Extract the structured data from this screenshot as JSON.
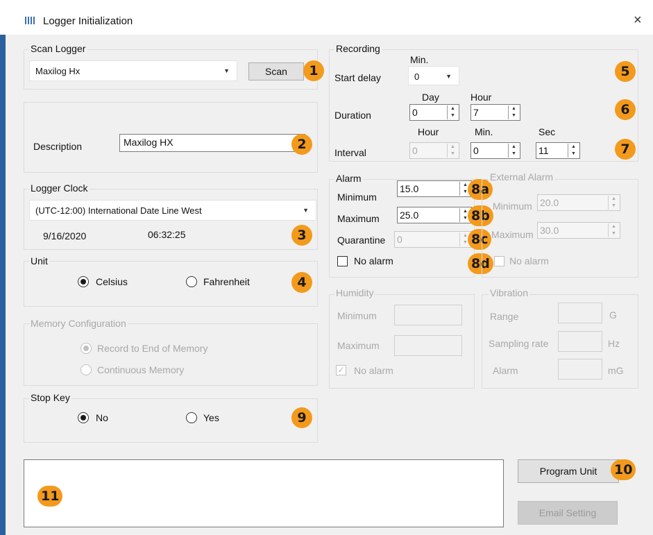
{
  "window": {
    "title": "Logger Initialization",
    "close_glyph": "×"
  },
  "scan_logger": {
    "group_label": "Scan Logger",
    "selected": "Maxilog Hx",
    "scan_label": "Scan",
    "badge": "1"
  },
  "description": {
    "label": "Description",
    "value": "Maxilog HX",
    "badge": "2"
  },
  "logger_clock": {
    "group_label": "Logger Clock",
    "timezone": "(UTC-12:00) International Date Line West",
    "date": "9/16/2020",
    "time": "06:32:25",
    "badge": "3"
  },
  "unit": {
    "group_label": "Unit",
    "celsius": "Celsius",
    "fahrenheit": "Fahrenheit",
    "selected": "Celsius",
    "badge": "4"
  },
  "memory": {
    "group_label": "Memory Configuration",
    "option1": "Record to End of Memory",
    "option2": "Continuous Memory"
  },
  "stop_key": {
    "group_label": "Stop Key",
    "no": "No",
    "yes": "Yes",
    "selected": "No",
    "badge": "9"
  },
  "recording": {
    "group_label": "Recording",
    "start_delay_label": "Start delay",
    "start_delay_unit": "Min.",
    "start_delay_value": "0",
    "badge_start": "5",
    "duration_label": "Duration",
    "duration_day_label": "Day",
    "duration_hour_label": "Hour",
    "duration_day": "0",
    "duration_hour": "7",
    "badge_duration": "6",
    "interval_label": "Interval",
    "interval_hour_label": "Hour",
    "interval_min_label": "Min.",
    "interval_sec_label": "Sec",
    "interval_hour": "0",
    "interval_min": "0",
    "interval_sec": "11",
    "badge_interval": "7"
  },
  "alarm": {
    "group_label": "Alarm",
    "minimum_label": "Minimum",
    "minimum_value": "15.0",
    "badge_min": "8a",
    "maximum_label": "Maximum",
    "maximum_value": "25.0",
    "badge_max": "8b",
    "quarantine_label": "Quarantine",
    "quarantine_value": "0",
    "badge_quarantine": "8c",
    "no_alarm_label": "No alarm",
    "badge_no_alarm": "8d"
  },
  "external_alarm": {
    "group_label": "External Alarm",
    "minimum_label": "Minimum",
    "minimum_value": "20.0",
    "maximum_label": "Maximum",
    "maximum_value": "30.0",
    "no_alarm_label": "No alarm"
  },
  "humidity": {
    "group_label": "Humidity",
    "minimum_label": "Minimum",
    "maximum_label": "Maximum",
    "no_alarm_label": "No alarm"
  },
  "vibration": {
    "group_label": "Vibration",
    "range_label": "Range",
    "range_unit": "G",
    "sampling_label": "Sampling rate",
    "sampling_unit": "Hz",
    "alarm_label": "Alarm",
    "alarm_unit": "mG"
  },
  "actions": {
    "program_unit": "Program Unit",
    "badge_program": "10",
    "email_setting": "Email Setting"
  },
  "log": {
    "badge": "11"
  },
  "colors": {
    "badge": "#f39a1c",
    "taskbar": "#2b5f9e"
  }
}
